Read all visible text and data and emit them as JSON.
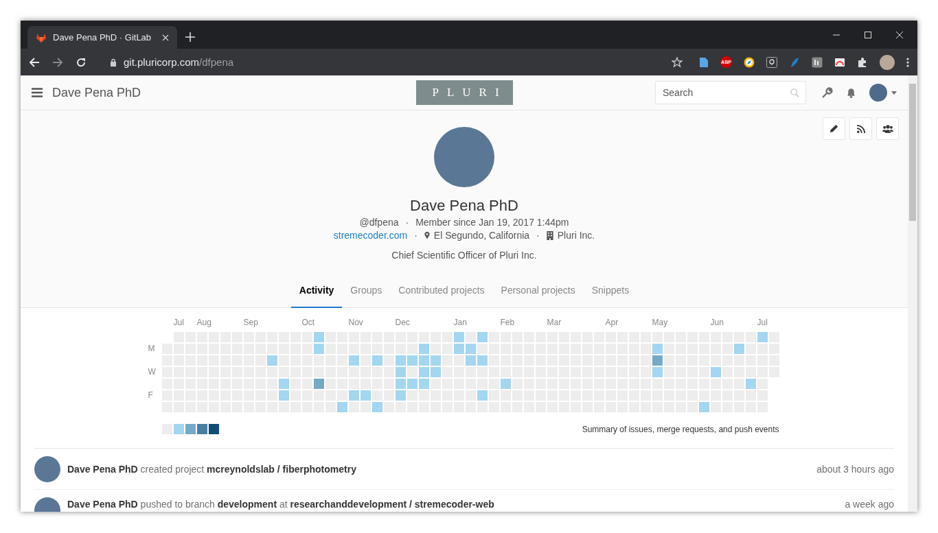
{
  "browser": {
    "tab_title": "Dave Pena PhD · GitLab",
    "url_domain": "git.pluricorp.com",
    "url_path": "/dfpena",
    "abp_badge": "ABP"
  },
  "navbar": {
    "title": "Dave Pena PhD",
    "logo": "PLURI",
    "search": {
      "placeholder": "Search"
    }
  },
  "profile": {
    "name": "Dave Pena PhD",
    "username": "@dfpena",
    "member_since": "Member since Jan 19, 2017 1:44pm",
    "separator": "·",
    "website": "stremecoder.com",
    "location": "El Segundo, California",
    "organization": "Pluri Inc.",
    "bio": "Chief Scientific Officer of Pluri Inc."
  },
  "tabs": [
    {
      "label": "Activity",
      "selected": true
    },
    {
      "label": "Groups",
      "selected": false
    },
    {
      "label": "Contributed projects",
      "selected": false
    },
    {
      "label": "Personal projects",
      "selected": false
    },
    {
      "label": "Snippets",
      "selected": false
    }
  ],
  "calendar": {
    "day_labels": [
      "M",
      "W",
      "F"
    ],
    "summary": "Summary of issues, merge requests, and push events",
    "legend": [
      {
        "color": "#ededed"
      },
      {
        "color": "#a3d6f1"
      },
      {
        "color": "#74aac8"
      },
      {
        "color": "#4a7f9f"
      },
      {
        "color": "#0f4d72"
      }
    ],
    "weeks": [
      {
        "days": [
          {
            "color": "#ededed"
          },
          {
            "color": "#ededed"
          },
          {
            "color": "#ededed"
          },
          {
            "color": "#ededed"
          },
          {
            "color": "#ededed"
          },
          {
            "color": "#ededed"
          }
        ]
      },
      {
        "month": "Jul",
        "days": [
          {
            "color": "#ededed"
          },
          {
            "color": "#ededed"
          },
          {
            "color": "#ededed"
          },
          {
            "color": "#ededed"
          },
          {
            "color": "#ededed"
          },
          {
            "color": "#ededed"
          },
          {
            "color": "#ededed"
          }
        ]
      },
      {
        "days": [
          {
            "color": "#ededed"
          },
          {
            "color": "#ededed"
          },
          {
            "color": "#ededed"
          },
          {
            "color": "#ededed"
          },
          {
            "color": "#ededed"
          },
          {
            "color": "#ededed"
          },
          {
            "color": "#ededed"
          }
        ]
      },
      {
        "month": "Aug",
        "days": [
          {
            "color": "#ededed"
          },
          {
            "color": "#ededed"
          },
          {
            "color": "#ededed"
          },
          {
            "color": "#ededed"
          },
          {
            "color": "#ededed"
          },
          {
            "color": "#ededed"
          },
          {
            "color": "#ededed"
          }
        ]
      },
      {
        "days": [
          {
            "color": "#ededed"
          },
          {
            "color": "#ededed"
          },
          {
            "color": "#ededed"
          },
          {
            "color": "#ededed"
          },
          {
            "color": "#ededed"
          },
          {
            "color": "#ededed"
          },
          {
            "color": "#ededed"
          }
        ]
      },
      {
        "days": [
          {
            "color": "#ededed"
          },
          {
            "color": "#ededed"
          },
          {
            "color": "#ededed"
          },
          {
            "color": "#ededed"
          },
          {
            "color": "#ededed"
          },
          {
            "color": "#ededed"
          },
          {
            "color": "#ededed"
          }
        ]
      },
      {
        "days": [
          {
            "color": "#ededed"
          },
          {
            "color": "#ededed"
          },
          {
            "color": "#ededed"
          },
          {
            "color": "#ededed"
          },
          {
            "color": "#ededed"
          },
          {
            "color": "#ededed"
          },
          {
            "color": "#ededed"
          }
        ]
      },
      {
        "month": "Sep",
        "days": [
          {
            "color": "#ededed"
          },
          {
            "color": "#ededed"
          },
          {
            "color": "#ededed"
          },
          {
            "color": "#ededed"
          },
          {
            "color": "#ededed"
          },
          {
            "color": "#ededed"
          },
          {
            "color": "#ededed"
          }
        ]
      },
      {
        "days": [
          {
            "color": "#ededed"
          },
          {
            "color": "#ededed"
          },
          {
            "color": "#ededed"
          },
          {
            "color": "#ededed"
          },
          {
            "color": "#ededed"
          },
          {
            "color": "#ededed"
          },
          {
            "color": "#ededed"
          }
        ]
      },
      {
        "days": [
          {
            "color": "#ededed"
          },
          {
            "color": "#ededed"
          },
          {
            "color": "#a3d6f1"
          },
          {
            "color": "#ededed"
          },
          {
            "color": "#ededed"
          },
          {
            "color": "#ededed"
          },
          {
            "color": "#ededed"
          }
        ]
      },
      {
        "days": [
          {
            "color": "#ededed"
          },
          {
            "color": "#ededed"
          },
          {
            "color": "#ededed"
          },
          {
            "color": "#ededed"
          },
          {
            "color": "#a3d6f1"
          },
          {
            "color": "#a3d6f1"
          },
          {
            "color": "#ededed"
          }
        ]
      },
      {
        "days": [
          {
            "color": "#ededed"
          },
          {
            "color": "#ededed"
          },
          {
            "color": "#ededed"
          },
          {
            "color": "#ededed"
          },
          {
            "color": "#ededed"
          },
          {
            "color": "#ededed"
          },
          {
            "color": "#ededed"
          }
        ]
      },
      {
        "month": "Oct",
        "days": [
          {
            "color": "#ededed"
          },
          {
            "color": "#ededed"
          },
          {
            "color": "#ededed"
          },
          {
            "color": "#ededed"
          },
          {
            "color": "#ededed"
          },
          {
            "color": "#ededed"
          },
          {
            "color": "#ededed"
          }
        ]
      },
      {
        "days": [
          {
            "color": "#a3d6f1"
          },
          {
            "color": "#a3d6f1"
          },
          {
            "color": "#ededed"
          },
          {
            "color": "#ededed"
          },
          {
            "color": "#74aac8"
          },
          {
            "color": "#ededed"
          },
          {
            "color": "#ededed"
          }
        ]
      },
      {
        "days": [
          {
            "color": "#ededed"
          },
          {
            "color": "#ededed"
          },
          {
            "color": "#ededed"
          },
          {
            "color": "#ededed"
          },
          {
            "color": "#ededed"
          },
          {
            "color": "#ededed"
          },
          {
            "color": "#ededed"
          }
        ]
      },
      {
        "days": [
          {
            "color": "#ededed"
          },
          {
            "color": "#ededed"
          },
          {
            "color": "#ededed"
          },
          {
            "color": "#ededed"
          },
          {
            "color": "#ededed"
          },
          {
            "color": "#ededed"
          },
          {
            "color": "#a3d6f1"
          }
        ]
      },
      {
        "month": "Nov",
        "days": [
          {
            "color": "#ededed"
          },
          {
            "color": "#ededed"
          },
          {
            "color": "#a3d6f1"
          },
          {
            "color": "#ededed"
          },
          {
            "color": "#ededed"
          },
          {
            "color": "#a3d6f1"
          },
          {
            "color": "#ededed"
          }
        ]
      },
      {
        "days": [
          {
            "color": "#ededed"
          },
          {
            "color": "#ededed"
          },
          {
            "color": "#ededed"
          },
          {
            "color": "#ededed"
          },
          {
            "color": "#ededed"
          },
          {
            "color": "#a3d6f1"
          },
          {
            "color": "#ededed"
          }
        ]
      },
      {
        "days": [
          {
            "color": "#ededed"
          },
          {
            "color": "#ededed"
          },
          {
            "color": "#a3d6f1"
          },
          {
            "color": "#ededed"
          },
          {
            "color": "#ededed"
          },
          {
            "color": "#ededed"
          },
          {
            "color": "#a3d6f1"
          }
        ]
      },
      {
        "days": [
          {
            "color": "#ededed"
          },
          {
            "color": "#ededed"
          },
          {
            "color": "#ededed"
          },
          {
            "color": "#ededed"
          },
          {
            "color": "#ededed"
          },
          {
            "color": "#ededed"
          },
          {
            "color": "#ededed"
          }
        ]
      },
      {
        "month": "Dec",
        "days": [
          {
            "color": "#ededed"
          },
          {
            "color": "#ededed"
          },
          {
            "color": "#a3d6f1"
          },
          {
            "color": "#a3d6f1"
          },
          {
            "color": "#a3d6f1"
          },
          {
            "color": "#a3d6f1"
          },
          {
            "color": "#ededed"
          }
        ]
      },
      {
        "days": [
          {
            "color": "#ededed"
          },
          {
            "color": "#ededed"
          },
          {
            "color": "#a3d6f1"
          },
          {
            "color": "#ededed"
          },
          {
            "color": "#a3d6f1"
          },
          {
            "color": "#ededed"
          },
          {
            "color": "#ededed"
          }
        ]
      },
      {
        "days": [
          {
            "color": "#ededed"
          },
          {
            "color": "#a3d6f1"
          },
          {
            "color": "#a3d6f1"
          },
          {
            "color": "#a3d6f1"
          },
          {
            "color": "#a3d6f1"
          },
          {
            "color": "#ededed"
          },
          {
            "color": "#ededed"
          }
        ]
      },
      {
        "days": [
          {
            "color": "#ededed"
          },
          {
            "color": "#ededed"
          },
          {
            "color": "#a3d6f1"
          },
          {
            "color": "#a3d6f1"
          },
          {
            "color": "#ededed"
          },
          {
            "color": "#ededed"
          },
          {
            "color": "#ededed"
          }
        ]
      },
      {
        "days": [
          {
            "color": "#ededed"
          },
          {
            "color": "#ededed"
          },
          {
            "color": "#ededed"
          },
          {
            "color": "#ededed"
          },
          {
            "color": "#ededed"
          },
          {
            "color": "#ededed"
          },
          {
            "color": "#ededed"
          }
        ]
      },
      {
        "month": "Jan",
        "days": [
          {
            "color": "#a3d6f1"
          },
          {
            "color": "#a3d6f1"
          },
          {
            "color": "#ededed"
          },
          {
            "color": "#ededed"
          },
          {
            "color": "#ededed"
          },
          {
            "color": "#ededed"
          },
          {
            "color": "#ededed"
          }
        ]
      },
      {
        "days": [
          {
            "color": "#ededed"
          },
          {
            "color": "#a3d6f1"
          },
          {
            "color": "#a3d6f1"
          },
          {
            "color": "#ededed"
          },
          {
            "color": "#ededed"
          },
          {
            "color": "#ededed"
          },
          {
            "color": "#ededed"
          }
        ]
      },
      {
        "days": [
          {
            "color": "#a3d6f1"
          },
          {
            "color": "#ededed"
          },
          {
            "color": "#a3d6f1"
          },
          {
            "color": "#ededed"
          },
          {
            "color": "#ededed"
          },
          {
            "color": "#a3d6f1"
          },
          {
            "color": "#ededed"
          }
        ]
      },
      {
        "days": [
          {
            "color": "#ededed"
          },
          {
            "color": "#ededed"
          },
          {
            "color": "#ededed"
          },
          {
            "color": "#ededed"
          },
          {
            "color": "#ededed"
          },
          {
            "color": "#ededed"
          },
          {
            "color": "#ededed"
          }
        ]
      },
      {
        "month": "Feb",
        "days": [
          {
            "color": "#ededed"
          },
          {
            "color": "#ededed"
          },
          {
            "color": "#ededed"
          },
          {
            "color": "#ededed"
          },
          {
            "color": "#a3d6f1"
          },
          {
            "color": "#ededed"
          },
          {
            "color": "#ededed"
          }
        ]
      },
      {
        "days": [
          {
            "color": "#ededed"
          },
          {
            "color": "#ededed"
          },
          {
            "color": "#ededed"
          },
          {
            "color": "#ededed"
          },
          {
            "color": "#ededed"
          },
          {
            "color": "#ededed"
          },
          {
            "color": "#ededed"
          }
        ]
      },
      {
        "days": [
          {
            "color": "#ededed"
          },
          {
            "color": "#ededed"
          },
          {
            "color": "#ededed"
          },
          {
            "color": "#ededed"
          },
          {
            "color": "#ededed"
          },
          {
            "color": "#ededed"
          },
          {
            "color": "#ededed"
          }
        ]
      },
      {
        "days": [
          {
            "color": "#ededed"
          },
          {
            "color": "#ededed"
          },
          {
            "color": "#ededed"
          },
          {
            "color": "#ededed"
          },
          {
            "color": "#ededed"
          },
          {
            "color": "#ededed"
          },
          {
            "color": "#ededed"
          }
        ]
      },
      {
        "month": "Mar",
        "days": [
          {
            "color": "#ededed"
          },
          {
            "color": "#ededed"
          },
          {
            "color": "#ededed"
          },
          {
            "color": "#ededed"
          },
          {
            "color": "#ededed"
          },
          {
            "color": "#ededed"
          },
          {
            "color": "#ededed"
          }
        ]
      },
      {
        "days": [
          {
            "color": "#ededed"
          },
          {
            "color": "#ededed"
          },
          {
            "color": "#ededed"
          },
          {
            "color": "#ededed"
          },
          {
            "color": "#ededed"
          },
          {
            "color": "#ededed"
          },
          {
            "color": "#ededed"
          }
        ]
      },
      {
        "days": [
          {
            "color": "#ededed"
          },
          {
            "color": "#ededed"
          },
          {
            "color": "#ededed"
          },
          {
            "color": "#ededed"
          },
          {
            "color": "#ededed"
          },
          {
            "color": "#ededed"
          },
          {
            "color": "#ededed"
          }
        ]
      },
      {
        "days": [
          {
            "color": "#ededed"
          },
          {
            "color": "#ededed"
          },
          {
            "color": "#ededed"
          },
          {
            "color": "#ededed"
          },
          {
            "color": "#ededed"
          },
          {
            "color": "#ededed"
          },
          {
            "color": "#ededed"
          }
        ]
      },
      {
        "days": [
          {
            "color": "#ededed"
          },
          {
            "color": "#ededed"
          },
          {
            "color": "#ededed"
          },
          {
            "color": "#ededed"
          },
          {
            "color": "#ededed"
          },
          {
            "color": "#ededed"
          },
          {
            "color": "#ededed"
          }
        ]
      },
      {
        "month": "Apr",
        "days": [
          {
            "color": "#ededed"
          },
          {
            "color": "#ededed"
          },
          {
            "color": "#ededed"
          },
          {
            "color": "#ededed"
          },
          {
            "color": "#ededed"
          },
          {
            "color": "#ededed"
          },
          {
            "color": "#ededed"
          }
        ]
      },
      {
        "days": [
          {
            "color": "#ededed"
          },
          {
            "color": "#ededed"
          },
          {
            "color": "#ededed"
          },
          {
            "color": "#ededed"
          },
          {
            "color": "#ededed"
          },
          {
            "color": "#ededed"
          },
          {
            "color": "#ededed"
          }
        ]
      },
      {
        "days": [
          {
            "color": "#ededed"
          },
          {
            "color": "#ededed"
          },
          {
            "color": "#ededed"
          },
          {
            "color": "#ededed"
          },
          {
            "color": "#ededed"
          },
          {
            "color": "#ededed"
          },
          {
            "color": "#ededed"
          }
        ]
      },
      {
        "days": [
          {
            "color": "#ededed"
          },
          {
            "color": "#ededed"
          },
          {
            "color": "#ededed"
          },
          {
            "color": "#ededed"
          },
          {
            "color": "#ededed"
          },
          {
            "color": "#ededed"
          },
          {
            "color": "#ededed"
          }
        ]
      },
      {
        "month": "May",
        "days": [
          {
            "color": "#ededed"
          },
          {
            "color": "#a3d6f1"
          },
          {
            "color": "#74aac8"
          },
          {
            "color": "#a3d6f1"
          },
          {
            "color": "#ededed"
          },
          {
            "color": "#ededed"
          },
          {
            "color": "#ededed"
          }
        ]
      },
      {
        "days": [
          {
            "color": "#ededed"
          },
          {
            "color": "#ededed"
          },
          {
            "color": "#ededed"
          },
          {
            "color": "#ededed"
          },
          {
            "color": "#ededed"
          },
          {
            "color": "#ededed"
          },
          {
            "color": "#ededed"
          }
        ]
      },
      {
        "days": [
          {
            "color": "#ededed"
          },
          {
            "color": "#ededed"
          },
          {
            "color": "#ededed"
          },
          {
            "color": "#ededed"
          },
          {
            "color": "#ededed"
          },
          {
            "color": "#ededed"
          },
          {
            "color": "#ededed"
          }
        ]
      },
      {
        "days": [
          {
            "color": "#ededed"
          },
          {
            "color": "#ededed"
          },
          {
            "color": "#ededed"
          },
          {
            "color": "#ededed"
          },
          {
            "color": "#ededed"
          },
          {
            "color": "#ededed"
          },
          {
            "color": "#ededed"
          }
        ]
      },
      {
        "days": [
          {
            "color": "#ededed"
          },
          {
            "color": "#ededed"
          },
          {
            "color": "#ededed"
          },
          {
            "color": "#ededed"
          },
          {
            "color": "#ededed"
          },
          {
            "color": "#ededed"
          },
          {
            "color": "#a3d6f1"
          }
        ]
      },
      {
        "month": "Jun",
        "days": [
          {
            "color": "#ededed"
          },
          {
            "color": "#ededed"
          },
          {
            "color": "#ededed"
          },
          {
            "color": "#a3d6f1"
          },
          {
            "color": "#ededed"
          },
          {
            "color": "#ededed"
          },
          {
            "color": "#ededed"
          }
        ]
      },
      {
        "days": [
          {
            "color": "#ededed"
          },
          {
            "color": "#ededed"
          },
          {
            "color": "#ededed"
          },
          {
            "color": "#ededed"
          },
          {
            "color": "#ededed"
          },
          {
            "color": "#ededed"
          },
          {
            "color": "#ededed"
          }
        ]
      },
      {
        "days": [
          {
            "color": "#ededed"
          },
          {
            "color": "#a3d6f1"
          },
          {
            "color": "#ededed"
          },
          {
            "color": "#ededed"
          },
          {
            "color": "#ededed"
          },
          {
            "color": "#ededed"
          },
          {
            "color": "#ededed"
          }
        ]
      },
      {
        "days": [
          {
            "color": "#ededed"
          },
          {
            "color": "#ededed"
          },
          {
            "color": "#ededed"
          },
          {
            "color": "#ededed"
          },
          {
            "color": "#a3d6f1"
          },
          {
            "color": "#ededed"
          },
          {
            "color": "#ededed"
          }
        ]
      },
      {
        "month": "Jul",
        "days": [
          {
            "color": "#a3d6f1"
          },
          {
            "color": "#ededed"
          },
          {
            "color": "#ededed"
          },
          {
            "color": "#ededed"
          },
          {
            "color": "#ededed"
          },
          {
            "color": "#ededed"
          },
          {
            "color": "#ededed"
          }
        ]
      },
      {
        "days": [
          {
            "color": "#ededed"
          },
          {
            "color": "#ededed"
          },
          {
            "color": "#ededed"
          },
          {
            "color": "#ededed"
          }
        ]
      }
    ]
  },
  "activity": [
    {
      "text": "**Dave Pena PhD** created project **mcreynoldslab / fiberphotometry**",
      "time": "about 3 hours ago"
    },
    {
      "text": "**Dave Pena PhD** pushed to branch **development** at **researchanddevelopment / stremecoder-web**",
      "time": "a week ago"
    }
  ]
}
